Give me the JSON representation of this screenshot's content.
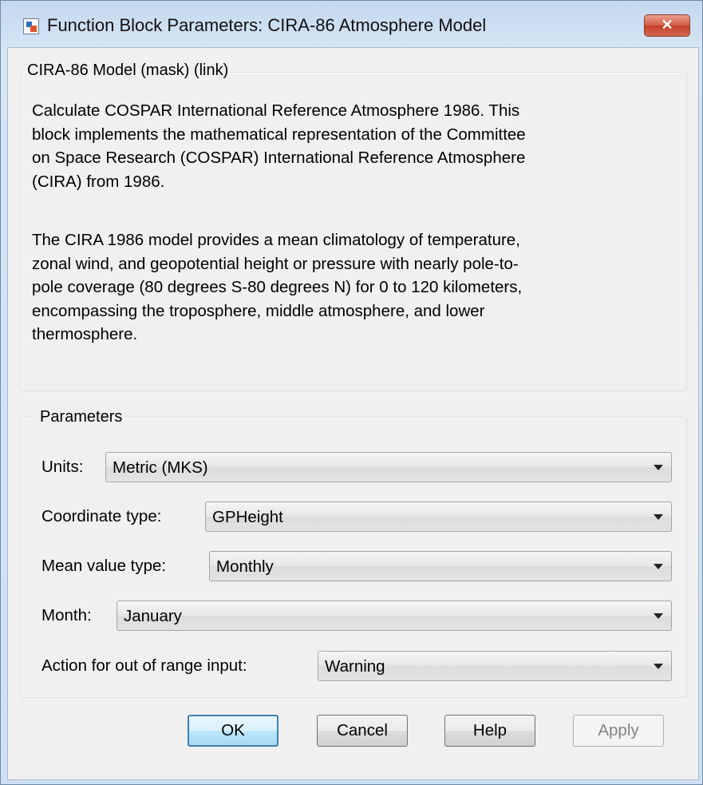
{
  "window": {
    "title": "Function Block Parameters: CIRA-86 Atmosphere Model",
    "close_label": "✕"
  },
  "description": {
    "group_title": "CIRA-86 Model (mask) (link)",
    "para1_lines": [
      "Calculate COSPAR International Reference Atmosphere 1986.  This",
      "block implements the mathematical representation of the Committee",
      "on Space Research  (COSPAR) International Reference Atmosphere",
      "(CIRA) from 1986."
    ],
    "para2_lines": [
      "The CIRA 1986 model provides a mean climatology of temperature,",
      "zonal wind, and geopotential height or pressure with nearly pole-to-",
      "pole coverage (80 degrees S-80 degrees N) for 0 to 120 kilometers,",
      "encompassing the troposphere, middle atmosphere, and lower",
      "thermosphere."
    ]
  },
  "parameters": {
    "group_title": "Parameters",
    "fields": [
      {
        "label": "Units:",
        "value": "Metric (MKS)"
      },
      {
        "label": "Coordinate type:",
        "value": "GPHeight"
      },
      {
        "label": "Mean value type:",
        "value": "Monthly"
      },
      {
        "label": "Month:",
        "value": "January"
      },
      {
        "label": "Action for out of range input:",
        "value": "Warning"
      }
    ]
  },
  "buttons": {
    "ok": "OK",
    "cancel": "Cancel",
    "help": "Help",
    "apply": "Apply"
  },
  "icons": {
    "app": "simulink-block-icon",
    "close": "close-icon",
    "dropdown": "chevron-down-icon"
  },
  "colors": {
    "title_bar": "#c4d8ee",
    "close_button": "#c9452c",
    "default_button_border": "#3c7fb1",
    "dialog_background": "#f0f0f0"
  }
}
